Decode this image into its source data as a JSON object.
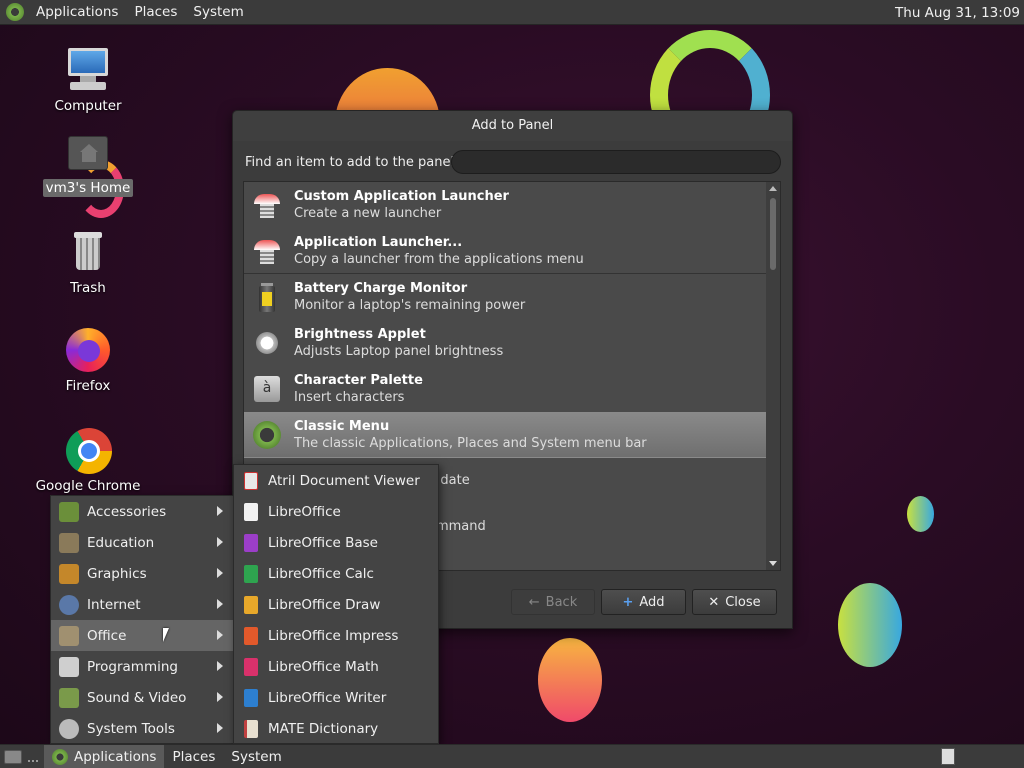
{
  "top_panel": {
    "menus": [
      "Applications",
      "Places",
      "System"
    ],
    "clock": "Thu Aug 31, 13:09"
  },
  "desktop_icons": [
    {
      "label": "Computer",
      "icon": "computer-icon"
    },
    {
      "label": "vm3's Home",
      "icon": "home-folder-icon"
    },
    {
      "label": "Trash",
      "icon": "trash-icon"
    },
    {
      "label": "Firefox",
      "icon": "firefox-icon"
    },
    {
      "label": "Google Chrome",
      "icon": "chrome-icon"
    }
  ],
  "dialog": {
    "title": "Add to Panel",
    "find_label": "Find an item to add to the panel:",
    "search_value": "",
    "items": [
      {
        "name": "Custom Application Launcher",
        "desc": "Create a new launcher",
        "icon": "launcher-icon"
      },
      {
        "name": "Application Launcher...",
        "desc": "Copy a launcher from the applications menu",
        "icon": "launcher-icon"
      },
      {
        "name": "Battery Charge Monitor",
        "desc": "Monitor a laptop's remaining power",
        "icon": "battery-icon"
      },
      {
        "name": "Brightness Applet",
        "desc": "Adjusts Laptop panel brightness",
        "icon": "brightness-icon"
      },
      {
        "name": "Character Palette",
        "desc": "Insert characters",
        "icon": "character-palette-icon"
      },
      {
        "name": "Classic Menu",
        "desc": "The classic Applications, Places and System menu bar",
        "icon": "mate-menu-icon"
      }
    ],
    "partial_texts": [
      "d date",
      "ommand"
    ],
    "buttons": {
      "back": "Back",
      "add": "Add",
      "close": "Close"
    }
  },
  "app_menu": {
    "categories": [
      {
        "label": "Accessories",
        "color": "#6b8f3a"
      },
      {
        "label": "Education",
        "color": "#8a7a5a"
      },
      {
        "label": "Graphics",
        "color": "#c4872a"
      },
      {
        "label": "Internet",
        "color": "#5a78a8"
      },
      {
        "label": "Office",
        "color": "#a09070"
      },
      {
        "label": "Programming",
        "color": "#cfcfcf"
      },
      {
        "label": "Sound & Video",
        "color": "#7a9a4a"
      },
      {
        "label": "System Tools",
        "color": "#bbbbbb"
      }
    ],
    "highlighted": "Office"
  },
  "office_menu": [
    {
      "label": "Atril Document Viewer",
      "color": "#e8e8e8"
    },
    {
      "label": "LibreOffice",
      "color": "#f2f2f2"
    },
    {
      "label": "LibreOffice Base",
      "color": "#9b3ec8"
    },
    {
      "label": "LibreOffice Calc",
      "color": "#2ea44f"
    },
    {
      "label": "LibreOffice Draw",
      "color": "#e8a82a"
    },
    {
      "label": "LibreOffice Impress",
      "color": "#e2592b"
    },
    {
      "label": "LibreOffice Math",
      "color": "#d9316b"
    },
    {
      "label": "LibreOffice Writer",
      "color": "#2d7fd0"
    },
    {
      "label": "MATE Dictionary",
      "color": "#c04040"
    }
  ],
  "bottom_panel": {
    "menus": [
      "Applications",
      "Places",
      "System"
    ]
  }
}
